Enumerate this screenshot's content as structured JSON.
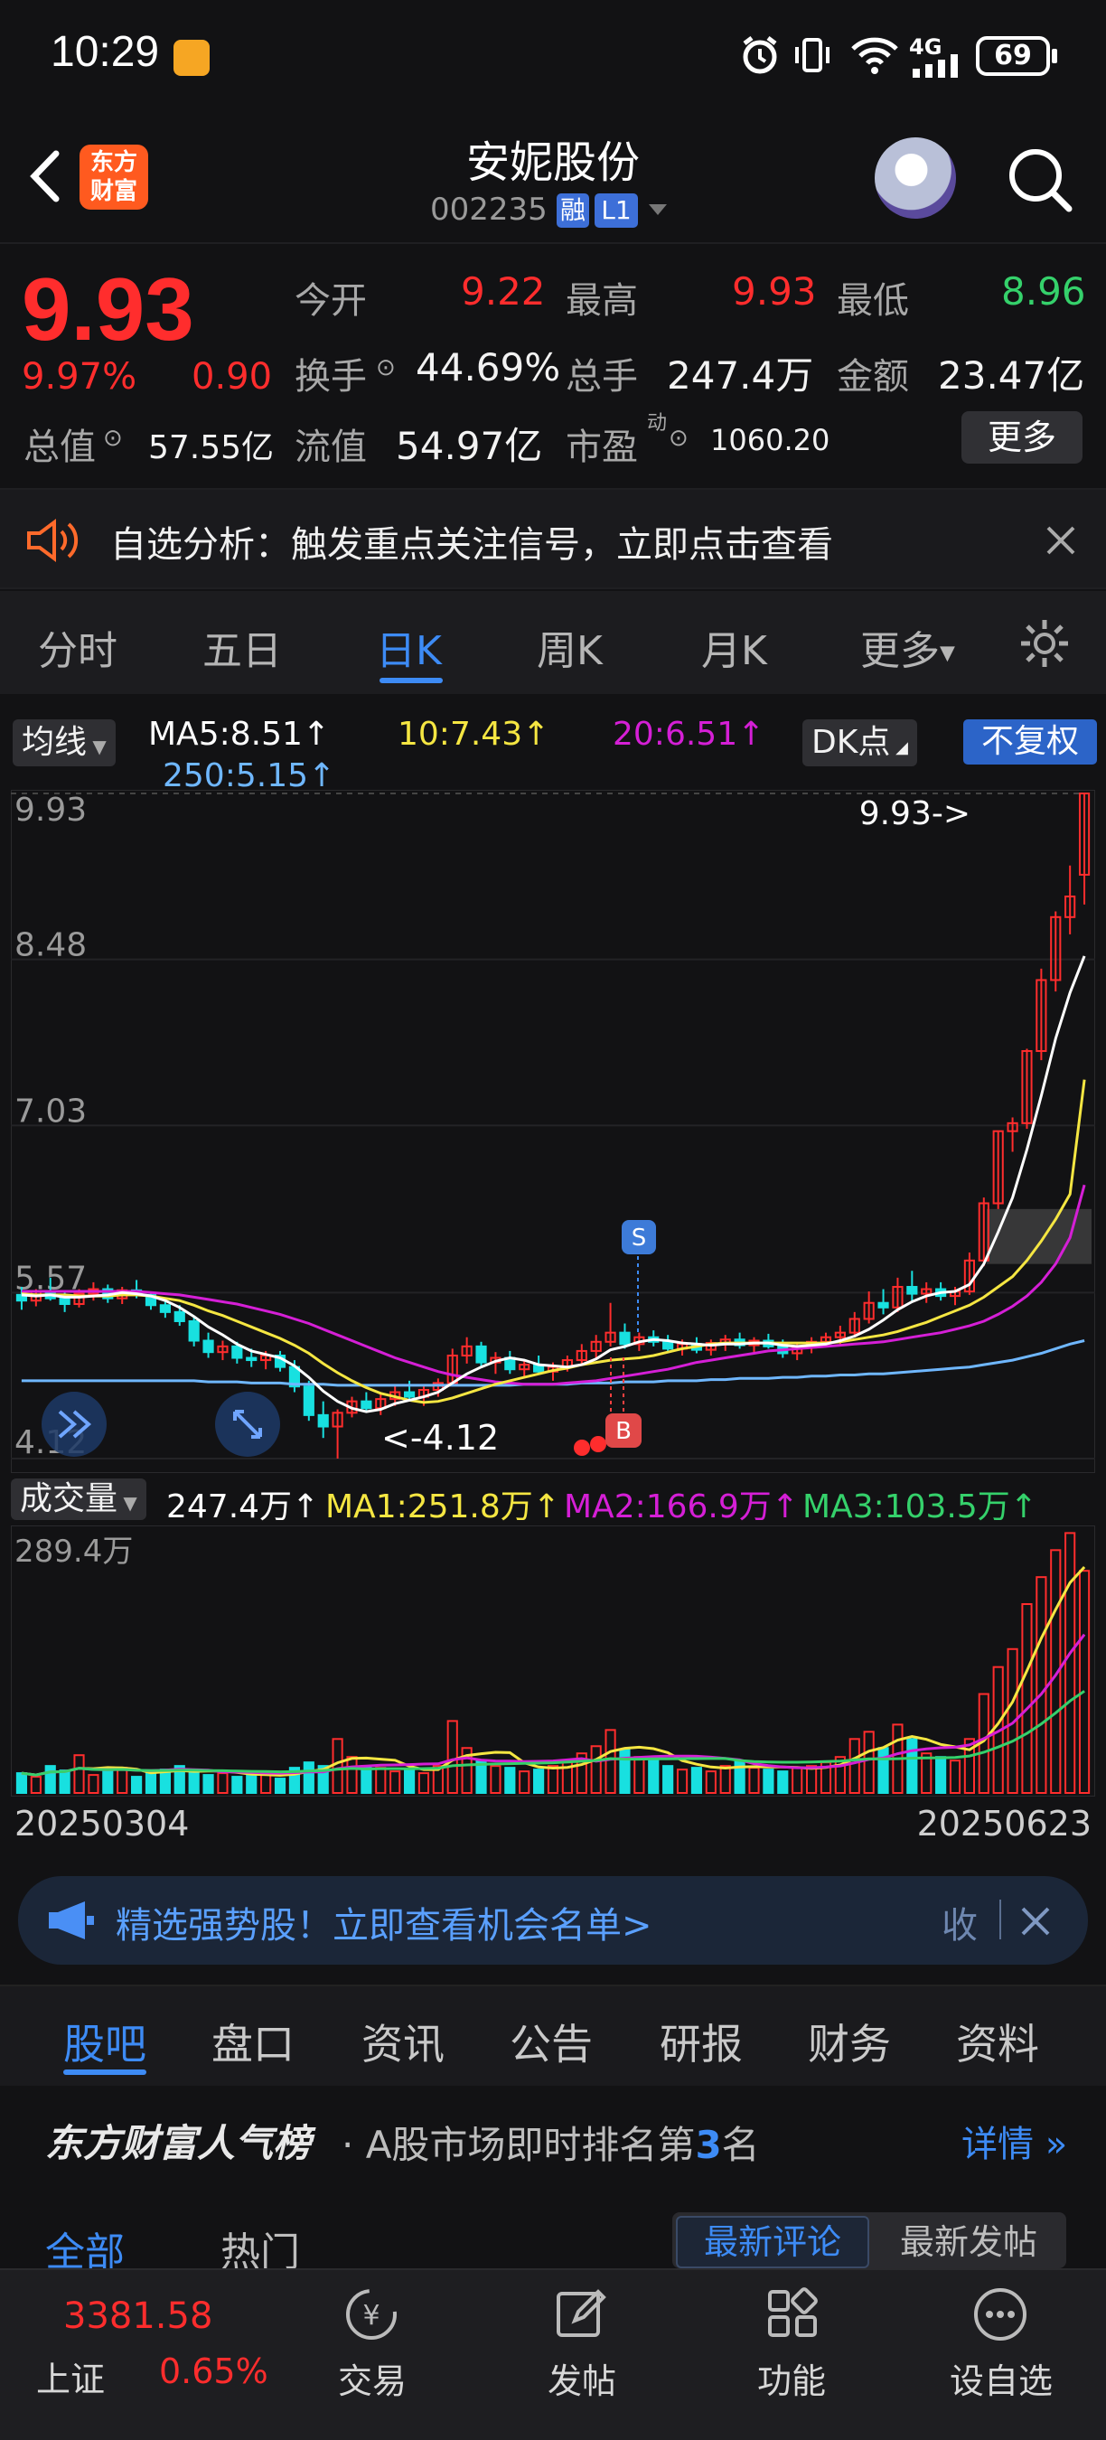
{
  "status_bar": {
    "time": "10:29",
    "network": "4G",
    "battery": "69"
  },
  "header": {
    "logo_text_line1": "东方",
    "logo_text_line2": "财富",
    "stock_name": "安妮股份",
    "stock_code": "002235",
    "tag_margin": "融",
    "tag_level": "L1"
  },
  "quote": {
    "price": "9.93",
    "change_pct": "9.97%",
    "change_amt": "0.90",
    "open_label": "今开",
    "open": "9.22",
    "high_label": "最高",
    "high": "9.93",
    "low_label": "最低",
    "low": "8.96",
    "turnover_label": "换手",
    "turnover": "44.69%",
    "volume_label": "总手",
    "volume": "247.4万",
    "amount_label": "金额",
    "amount": "23.47亿",
    "market_cap_label": "总值",
    "market_cap": "57.55亿",
    "float_cap_label": "流值",
    "float_cap": "54.97亿",
    "pe_label": "市盈",
    "pe_superscript": "动",
    "pe": "1060.20",
    "more_label": "更多"
  },
  "alert": {
    "text": "自选分析：触发重点关注信号，立即点击查看"
  },
  "kline_tabs": {
    "items": [
      "分时",
      "五日",
      "日K",
      "周K",
      "月K",
      "更多"
    ],
    "active": "日K"
  },
  "ma_legend": {
    "selector": "均线",
    "ma5": "MA5:8.51↑",
    "ma10": "10:7.43↑",
    "ma20": "20:6.51↑",
    "ma250": "250:5.15↑",
    "dk_label": "DK点",
    "adjust_label": "不复权"
  },
  "chart_data": [
    {
      "type": "candlestick",
      "title": "",
      "y_ticks": [
        "9.93",
        "8.48",
        "7.03",
        "5.57",
        "4.12"
      ],
      "ylim": [
        4.12,
        9.93
      ],
      "x_range": [
        "20250304",
        "20250623"
      ],
      "annotations": {
        "max": "9.93->",
        "min": "<-4.12",
        "sell_marker": "S",
        "buy_marker": "B"
      },
      "ma_colors": {
        "ma5": "#ffffff",
        "ma10": "#f5e642",
        "ma20": "#d51fd6",
        "ma250": "#6fb7ff"
      },
      "ohlc": [
        [
          5.55,
          5.62,
          5.42,
          5.5
        ],
        [
          5.5,
          5.6,
          5.45,
          5.58
        ],
        [
          5.58,
          5.7,
          5.5,
          5.52
        ],
        [
          5.52,
          5.58,
          5.4,
          5.47
        ],
        [
          5.47,
          5.6,
          5.44,
          5.56
        ],
        [
          5.56,
          5.66,
          5.5,
          5.6
        ],
        [
          5.6,
          5.64,
          5.48,
          5.52
        ],
        [
          5.52,
          5.62,
          5.47,
          5.59
        ],
        [
          5.59,
          5.68,
          5.52,
          5.55
        ],
        [
          5.55,
          5.58,
          5.42,
          5.46
        ],
        [
          5.46,
          5.52,
          5.35,
          5.4
        ],
        [
          5.4,
          5.46,
          5.28,
          5.32
        ],
        [
          5.32,
          5.36,
          5.1,
          5.15
        ],
        [
          5.15,
          5.22,
          5.0,
          5.05
        ],
        [
          5.05,
          5.15,
          4.98,
          5.1
        ],
        [
          5.1,
          5.14,
          4.95,
          5.0
        ],
        [
          5.0,
          5.08,
          4.92,
          4.98
        ],
        [
          4.98,
          5.06,
          4.9,
          5.02
        ],
        [
          5.02,
          5.06,
          4.88,
          4.92
        ],
        [
          4.92,
          4.98,
          4.7,
          4.75
        ],
        [
          4.75,
          4.8,
          4.45,
          4.5
        ],
        [
          4.5,
          4.62,
          4.3,
          4.4
        ],
        [
          4.4,
          4.55,
          4.12,
          4.52
        ],
        [
          4.52,
          4.66,
          4.48,
          4.62
        ],
        [
          4.62,
          4.7,
          4.52,
          4.56
        ],
        [
          4.56,
          4.68,
          4.5,
          4.64
        ],
        [
          4.64,
          4.76,
          4.58,
          4.7
        ],
        [
          4.7,
          4.8,
          4.62,
          4.66
        ],
        [
          4.66,
          4.75,
          4.58,
          4.72
        ],
        [
          4.72,
          4.82,
          4.66,
          4.78
        ],
        [
          4.78,
          5.08,
          4.75,
          5.02
        ],
        [
          5.02,
          5.18,
          4.95,
          5.1
        ],
        [
          5.1,
          5.14,
          4.92,
          4.96
        ],
        [
          4.96,
          5.05,
          4.86,
          5.0
        ],
        [
          5.0,
          5.06,
          4.86,
          4.9
        ],
        [
          4.9,
          4.98,
          4.82,
          4.94
        ],
        [
          4.94,
          5.02,
          4.86,
          4.88
        ],
        [
          4.88,
          4.96,
          4.8,
          4.92
        ],
        [
          4.92,
          5.02,
          4.88,
          4.98
        ],
        [
          4.98,
          5.12,
          4.94,
          5.06
        ],
        [
          5.06,
          5.2,
          5.0,
          5.14
        ],
        [
          5.14,
          5.48,
          5.1,
          5.22
        ],
        [
          5.22,
          5.3,
          5.08,
          5.12
        ],
        [
          5.12,
          5.22,
          5.06,
          5.18
        ],
        [
          5.18,
          5.24,
          5.1,
          5.14
        ],
        [
          5.14,
          5.2,
          5.05,
          5.08
        ],
        [
          5.08,
          5.16,
          5.02,
          5.12
        ],
        [
          5.12,
          5.18,
          5.04,
          5.07
        ],
        [
          5.07,
          5.16,
          5.02,
          5.13
        ],
        [
          5.13,
          5.2,
          5.06,
          5.16
        ],
        [
          5.16,
          5.22,
          5.08,
          5.11
        ],
        [
          5.11,
          5.18,
          5.05,
          5.15
        ],
        [
          5.15,
          5.21,
          5.08,
          5.1
        ],
        [
          5.1,
          5.16,
          5.0,
          5.04
        ],
        [
          5.04,
          5.12,
          4.98,
          5.09
        ],
        [
          5.09,
          5.18,
          5.04,
          5.14
        ],
        [
          5.14,
          5.22,
          5.1,
          5.18
        ],
        [
          5.18,
          5.28,
          5.12,
          5.22
        ],
        [
          5.22,
          5.4,
          5.18,
          5.34
        ],
        [
          5.34,
          5.58,
          5.3,
          5.48
        ],
        [
          5.48,
          5.6,
          5.38,
          5.44
        ],
        [
          5.44,
          5.7,
          5.4,
          5.62
        ],
        [
          5.62,
          5.76,
          5.5,
          5.56
        ],
        [
          5.56,
          5.66,
          5.48,
          5.6
        ],
        [
          5.6,
          5.66,
          5.5,
          5.54
        ],
        [
          5.54,
          5.62,
          5.46,
          5.58
        ],
        [
          5.58,
          5.92,
          5.55,
          5.85
        ],
        [
          5.85,
          6.4,
          5.8,
          6.35
        ],
        [
          6.35,
          6.98,
          6.3,
          6.98
        ],
        [
          6.98,
          7.1,
          6.8,
          7.05
        ],
        [
          7.05,
          7.7,
          7.0,
          7.68
        ],
        [
          7.68,
          8.4,
          7.6,
          8.3
        ],
        [
          8.3,
          8.9,
          8.2,
          8.85
        ],
        [
          8.85,
          9.3,
          8.7,
          9.03
        ],
        [
          9.22,
          9.93,
          8.96,
          9.93
        ]
      ],
      "ma5": [
        5.55,
        5.54,
        5.55,
        5.53,
        5.53,
        5.54,
        5.55,
        5.57,
        5.56,
        5.54,
        5.5,
        5.44,
        5.36,
        5.27,
        5.2,
        5.12,
        5.06,
        5.03,
        5.0,
        4.93,
        4.83,
        4.71,
        4.62,
        4.56,
        4.53,
        4.55,
        4.6,
        4.63,
        4.66,
        4.7,
        4.78,
        4.86,
        4.92,
        4.97,
        5.0,
        4.98,
        4.94,
        4.93,
        4.92,
        4.94,
        4.99,
        5.07,
        5.1,
        5.14,
        5.16,
        5.15,
        5.13,
        5.12,
        5.11,
        5.12,
        5.12,
        5.13,
        5.13,
        5.11,
        5.1,
        5.11,
        5.12,
        5.15,
        5.19,
        5.25,
        5.33,
        5.42,
        5.49,
        5.54,
        5.57,
        5.58,
        5.64,
        5.82,
        6.1,
        6.4,
        6.82,
        7.29,
        7.79,
        8.19,
        8.51
      ],
      "ma10": [
        5.56,
        5.55,
        5.55,
        5.55,
        5.54,
        5.54,
        5.54,
        5.55,
        5.55,
        5.54,
        5.52,
        5.5,
        5.46,
        5.41,
        5.37,
        5.32,
        5.27,
        5.22,
        5.17,
        5.11,
        5.04,
        4.95,
        4.87,
        4.8,
        4.74,
        4.69,
        4.66,
        4.63,
        4.61,
        4.62,
        4.65,
        4.69,
        4.73,
        4.77,
        4.8,
        4.83,
        4.86,
        4.89,
        4.91,
        4.94,
        4.96,
        4.98,
        4.99,
        5.0,
        5.02,
        5.05,
        5.08,
        5.1,
        5.12,
        5.13,
        5.13,
        5.13,
        5.13,
        5.13,
        5.13,
        5.13,
        5.13,
        5.14,
        5.16,
        5.18,
        5.2,
        5.23,
        5.27,
        5.31,
        5.36,
        5.41,
        5.46,
        5.53,
        5.62,
        5.71,
        5.85,
        6.02,
        6.21,
        6.43,
        7.43
      ],
      "ma20": [
        5.58,
        5.58,
        5.58,
        5.58,
        5.58,
        5.58,
        5.58,
        5.58,
        5.58,
        5.57,
        5.56,
        5.55,
        5.53,
        5.51,
        5.49,
        5.47,
        5.44,
        5.41,
        5.38,
        5.34,
        5.3,
        5.25,
        5.2,
        5.15,
        5.1,
        5.05,
        5.0,
        4.96,
        4.92,
        4.88,
        4.85,
        4.83,
        4.81,
        4.79,
        4.78,
        4.77,
        4.77,
        4.77,
        4.78,
        4.79,
        4.8,
        4.82,
        4.84,
        4.86,
        4.88,
        4.9,
        4.93,
        4.96,
        4.98,
        5.0,
        5.02,
        5.04,
        5.06,
        5.07,
        5.08,
        5.09,
        5.1,
        5.11,
        5.12,
        5.13,
        5.14,
        5.16,
        5.18,
        5.2,
        5.22,
        5.25,
        5.28,
        5.32,
        5.38,
        5.45,
        5.54,
        5.66,
        5.82,
        6.05,
        6.51
      ],
      "ma250": [
        4.8,
        4.8,
        4.8,
        4.8,
        4.8,
        4.8,
        4.8,
        4.8,
        4.8,
        4.8,
        4.8,
        4.8,
        4.8,
        4.79,
        4.79,
        4.79,
        4.78,
        4.78,
        4.78,
        4.77,
        4.77,
        4.77,
        4.76,
        4.76,
        4.76,
        4.76,
        4.76,
        4.76,
        4.76,
        4.76,
        4.76,
        4.76,
        4.76,
        4.76,
        4.76,
        4.77,
        4.77,
        4.77,
        4.77,
        4.78,
        4.78,
        4.78,
        4.79,
        4.79,
        4.79,
        4.8,
        4.8,
        4.8,
        4.81,
        4.81,
        4.82,
        4.82,
        4.82,
        4.83,
        4.83,
        4.84,
        4.84,
        4.85,
        4.85,
        4.86,
        4.86,
        4.87,
        4.88,
        4.89,
        4.9,
        4.91,
        4.92,
        4.94,
        4.96,
        4.98,
        5.01,
        5.04,
        5.08,
        5.12,
        5.15
      ]
    },
    {
      "type": "bar",
      "title": "",
      "indicator": "成交量",
      "value_label": "247.4万↑",
      "ma1": "MA1:251.8万↑",
      "ma2": "MA2:166.9万↑",
      "ma3": "MA3:103.5万↑",
      "y_max_label": "289.4万",
      "ylim": [
        0,
        289.4
      ],
      "x_ticks": [
        "20250304",
        "20250623"
      ],
      "volume": [
        22,
        18,
        30,
        25,
        42,
        20,
        24,
        28,
        18,
        22,
        26,
        30,
        24,
        20,
        22,
        18,
        20,
        22,
        16,
        28,
        34,
        30,
        60,
        40,
        30,
        28,
        24,
        26,
        22,
        30,
        80,
        50,
        36,
        30,
        28,
        24,
        26,
        30,
        34,
        44,
        52,
        70,
        48,
        40,
        36,
        30,
        26,
        28,
        24,
        30,
        36,
        28,
        26,
        24,
        28,
        30,
        34,
        40,
        60,
        68,
        50,
        76,
        60,
        44,
        40,
        36,
        60,
        110,
        140,
        160,
        210,
        240,
        270,
        289,
        247
      ]
    }
  ],
  "promo": {
    "text": "精选强势股！立即查看机会名单>",
    "collapse": "收"
  },
  "bottom_tabs": {
    "items": [
      "股吧",
      "盘口",
      "资讯",
      "公告",
      "研报",
      "财务",
      "资料"
    ],
    "active": "股吧"
  },
  "rank": {
    "brand": "东方财富人气榜",
    "text_pre": "· A股市场即时排名第",
    "rank_no": "3",
    "text_post": "名",
    "detail": "详情"
  },
  "feed_tabs": {
    "all": "全部",
    "hot": "热门",
    "latest_comment": "最新评论",
    "latest_post": "最新发帖"
  },
  "bottom_nav": {
    "index_value": "3381.58",
    "index_name": "上证",
    "index_change": "0.65%",
    "trade": "交易",
    "post": "发帖",
    "function": "功能",
    "watchlist": "设自选"
  }
}
